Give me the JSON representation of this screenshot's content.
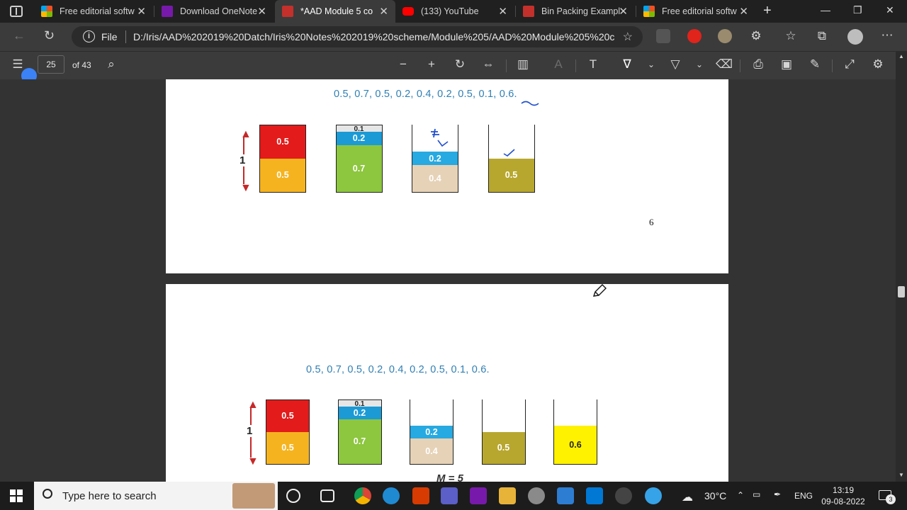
{
  "tabs": [
    {
      "title": "Free editorial softw",
      "favicon": "microsoft-logo-icon",
      "active": false
    },
    {
      "title": "Download OneNote",
      "favicon": "onenote-icon",
      "active": false
    },
    {
      "title": "*AAD Module 5 co",
      "favicon": "pdf-icon",
      "active": true
    },
    {
      "title": "(133) YouTube",
      "favicon": "youtube-icon",
      "active": false
    },
    {
      "title": "Bin Packing Exampl",
      "favicon": "pdf-icon",
      "active": false
    },
    {
      "title": "Free editorial softw",
      "favicon": "microsoft-logo-icon",
      "active": false
    }
  ],
  "address": {
    "scheme_label": "File",
    "url": "D:/Iris/AAD%202019%20Datch/Iris%20Notes%202019%20scheme/Module%205/AAD%20Module%205%20c..."
  },
  "pdf_toolbar": {
    "page_number": "25",
    "page_of": "of 43"
  },
  "page_a": {
    "sequence": "0.5,  0.7,  0.5,  0.2,  0.4,  0.2,  0.5,  0.1,  0.6.",
    "capacity_label": "1",
    "page_number": "6",
    "bins": [
      {
        "segments": [
          {
            "label": "0.5",
            "value": 0.5,
            "color": "#f5b41f"
          },
          {
            "label": "0.5",
            "value": 0.5,
            "color": "#e31b1b"
          }
        ]
      },
      {
        "segments": [
          {
            "label": "0.7",
            "value": 0.7,
            "color": "#8dc63f"
          },
          {
            "label": "0.2",
            "value": 0.2,
            "color": "#1b9ad6"
          },
          {
            "label": "0.1",
            "value": 0.1,
            "color": "#e6e6e6"
          }
        ]
      },
      {
        "segments": [
          {
            "label": "0.4",
            "value": 0.4,
            "color": "#e6d2b7"
          },
          {
            "label": "0.2",
            "value": 0.2,
            "color": "#27a9e1"
          }
        ]
      },
      {
        "segments": [
          {
            "label": "0.5",
            "value": 0.5,
            "color": "#b7a72e"
          }
        ]
      }
    ]
  },
  "page_b": {
    "sequence": "0.5,  0.7,  0.5,  0.2,  0.4,  0.2,  0.5,  0.1,  0.6.",
    "capacity_label": "1",
    "footer_text": "M = 5",
    "bins": [
      {
        "segments": [
          {
            "label": "0.5",
            "value": 0.5,
            "color": "#f5b41f"
          },
          {
            "label": "0.5",
            "value": 0.5,
            "color": "#e31b1b"
          }
        ]
      },
      {
        "segments": [
          {
            "label": "0.7",
            "value": 0.7,
            "color": "#8dc63f"
          },
          {
            "label": "0.2",
            "value": 0.2,
            "color": "#1b9ad6"
          },
          {
            "label": "0.1",
            "value": 0.1,
            "color": "#e6e6e6"
          }
        ]
      },
      {
        "segments": [
          {
            "label": "0.4",
            "value": 0.4,
            "color": "#e6d2b7"
          },
          {
            "label": "0.2",
            "value": 0.2,
            "color": "#27a9e1"
          }
        ]
      },
      {
        "segments": [
          {
            "label": "0.5",
            "value": 0.5,
            "color": "#b7a72e"
          }
        ]
      },
      {
        "segments": [
          {
            "label": "0.6",
            "value": 0.6,
            "color": "#fff200"
          }
        ]
      }
    ]
  },
  "taskbar": {
    "search_placeholder": "Type here to search",
    "weather": "30°C",
    "language": "ENG",
    "time": "13:19",
    "date": "09-08-2022",
    "notification_count": "3"
  }
}
